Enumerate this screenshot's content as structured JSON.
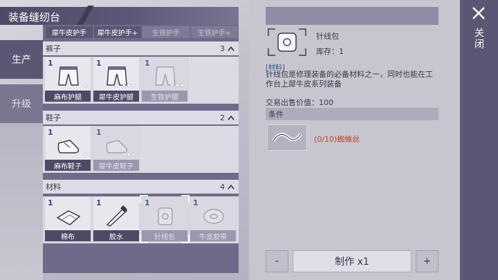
{
  "title": "装备缝纫台",
  "tabs": [
    {
      "label": "生产",
      "active": true
    },
    {
      "label": "升级",
      "active": false
    }
  ],
  "top_items": [
    {
      "label": "犀牛皮护手",
      "dim": false
    },
    {
      "label": "犀牛皮护手+",
      "dim": false
    },
    {
      "label": "生铁护手",
      "dim": true
    },
    {
      "label": "生铁护手+",
      "dim": true
    }
  ],
  "sections": [
    {
      "name": "裤子",
      "count": "3",
      "items": [
        {
          "qty": "1",
          "label": "麻布护腿",
          "stars": "★",
          "icon": "pants-icon",
          "dim": false
        },
        {
          "qty": "1",
          "label": "犀牛皮护腿",
          "stars": "★★★",
          "icon": "pants-icon",
          "dim": false
        },
        {
          "qty": "1",
          "label": "生铁护腿",
          "stars": "★★★",
          "icon": "pants-icon",
          "dim": true
        }
      ]
    },
    {
      "name": "鞋子",
      "count": "2",
      "items": [
        {
          "qty": "1",
          "label": "麻布鞋子",
          "stars": "★",
          "icon": "shoe-icon",
          "dim": false
        },
        {
          "qty": "1",
          "label": "犀牛皮鞋子",
          "stars": "★★★",
          "icon": "shoe-icon",
          "dim": true
        }
      ]
    },
    {
      "name": "材料",
      "count": "4",
      "items": [
        {
          "qty": "1",
          "label": "棉布",
          "stars": "",
          "icon": "cloth-icon",
          "dim": false
        },
        {
          "qty": "1",
          "label": "胶水",
          "stars": "",
          "icon": "glue-icon",
          "dim": false
        },
        {
          "qty": "1",
          "label": "针线包",
          "stars": "",
          "icon": "sewing-kit-icon",
          "dim": true,
          "selected": true
        },
        {
          "qty": "1",
          "label": "牛皮胶带",
          "stars": "",
          "icon": "tape-icon",
          "dim": true
        }
      ]
    }
  ],
  "detail": {
    "name": "针线包",
    "stock": "库存：1",
    "category": "[材料]",
    "description": "针线包是修理装备的必备材料之一，同时也能在工作台上犀牛皮系列装备",
    "price": "交易出售价值：100",
    "conditions_header": "条件",
    "condition": "(0/10)蜘蛛丝"
  },
  "controls": {
    "minus": "-",
    "craft": "制作 x1",
    "plus": "+"
  },
  "close_label": "关闭",
  "colors": {
    "panel": "#6f6a89",
    "accent_text": "#b54a2e",
    "qty_blue": "#2c4f8c"
  }
}
